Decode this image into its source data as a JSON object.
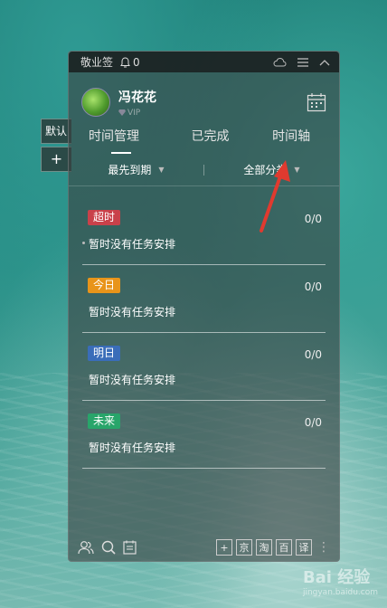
{
  "side_tabs": {
    "default_label": "默认",
    "add_label": "+"
  },
  "titlebar": {
    "app_name": "敬业签",
    "notice_count": "0"
  },
  "user": {
    "name": "冯花花",
    "vip_label": "VIP"
  },
  "tabs": [
    {
      "label": "时间管理",
      "active": true
    },
    {
      "label": "已完成",
      "active": false
    },
    {
      "label": "时间轴",
      "active": false
    }
  ],
  "filters": {
    "sort_label": "最先到期",
    "category_label": "全部分类"
  },
  "sections": [
    {
      "badge": "超时",
      "color": "#c9414a",
      "count": "0/0",
      "empty_text": "暂时没有任务安排"
    },
    {
      "badge": "今日",
      "color": "#e8941a",
      "count": "0/0",
      "empty_text": "暂时没有任务安排"
    },
    {
      "badge": "明日",
      "color": "#3a6db9",
      "count": "0/0",
      "empty_text": "暂时没有任务安排"
    },
    {
      "badge": "未来",
      "color": "#28a56a",
      "count": "0/0",
      "empty_text": "暂时没有任务安排"
    }
  ],
  "toolbar": {
    "buttons": [
      "+",
      "京",
      "淘",
      "百",
      "译"
    ]
  },
  "watermark": {
    "brand": "Bai 经验",
    "sub": "jingyan.baidu.com"
  },
  "accent": {
    "arrow": "#e03a2f"
  }
}
